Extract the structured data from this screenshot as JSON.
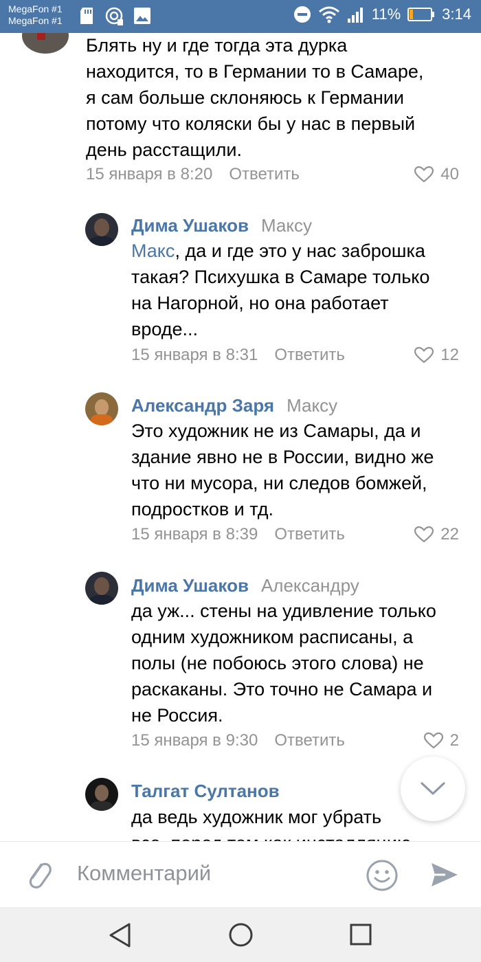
{
  "status_bar": {
    "carrier_1": "MegaFon #1",
    "carrier_2": "MegaFon #1",
    "battery": "11%",
    "time": "3:14",
    "background": "#4a76a8"
  },
  "comments": [
    {
      "text_lines": [
        "Блять ну и где тогда эта дурка",
        "находится, то в Германии то в Самаре,",
        "я сам больше склоняюсь к Германии",
        "потому что коляски бы у нас в первый",
        "день расстащили."
      ],
      "date": "15 января в 8:20",
      "reply_label": "Ответить",
      "likes": "40"
    },
    {
      "author": "Дима Ушаков",
      "addressee": "Максу",
      "mention": "Макс",
      "text_lines": [
        ", да и где это у нас заброшка",
        "такая? Психушка в Самаре только",
        "на Нагорной, но она работает",
        "вроде..."
      ],
      "date": "15 января в 8:31",
      "reply_label": "Ответить",
      "likes": "12"
    },
    {
      "author": "Александр Заря",
      "addressee": "Максу",
      "text_lines": [
        "Это художник не из Самары, да и",
        "здание явно не в России, видно же",
        "что ни мусора, ни следов бомжей,",
        "подростков и тд."
      ],
      "date": "15 января в 8:39",
      "reply_label": "Ответить",
      "likes": "22"
    },
    {
      "author": "Дима Ушаков",
      "addressee": "Александру",
      "text_lines": [
        "да уж... стены на удивление только",
        "одним художником расписаны, а",
        "полы (не побоюсь этого слова) не",
        "раскаканы. Это точно не Самара и",
        "не Россия."
      ],
      "date": "15 января в 9:30",
      "reply_label": "Ответить",
      "likes": "2"
    },
    {
      "author": "Талгат Султанов",
      "text_lines": [
        "да ведь художник мог убрать",
        "все, перед тем как инсталляцию"
      ]
    }
  ],
  "input": {
    "placeholder": "Комментарий"
  },
  "colors": {
    "accent": "#4a76a8",
    "meta": "#939393"
  }
}
